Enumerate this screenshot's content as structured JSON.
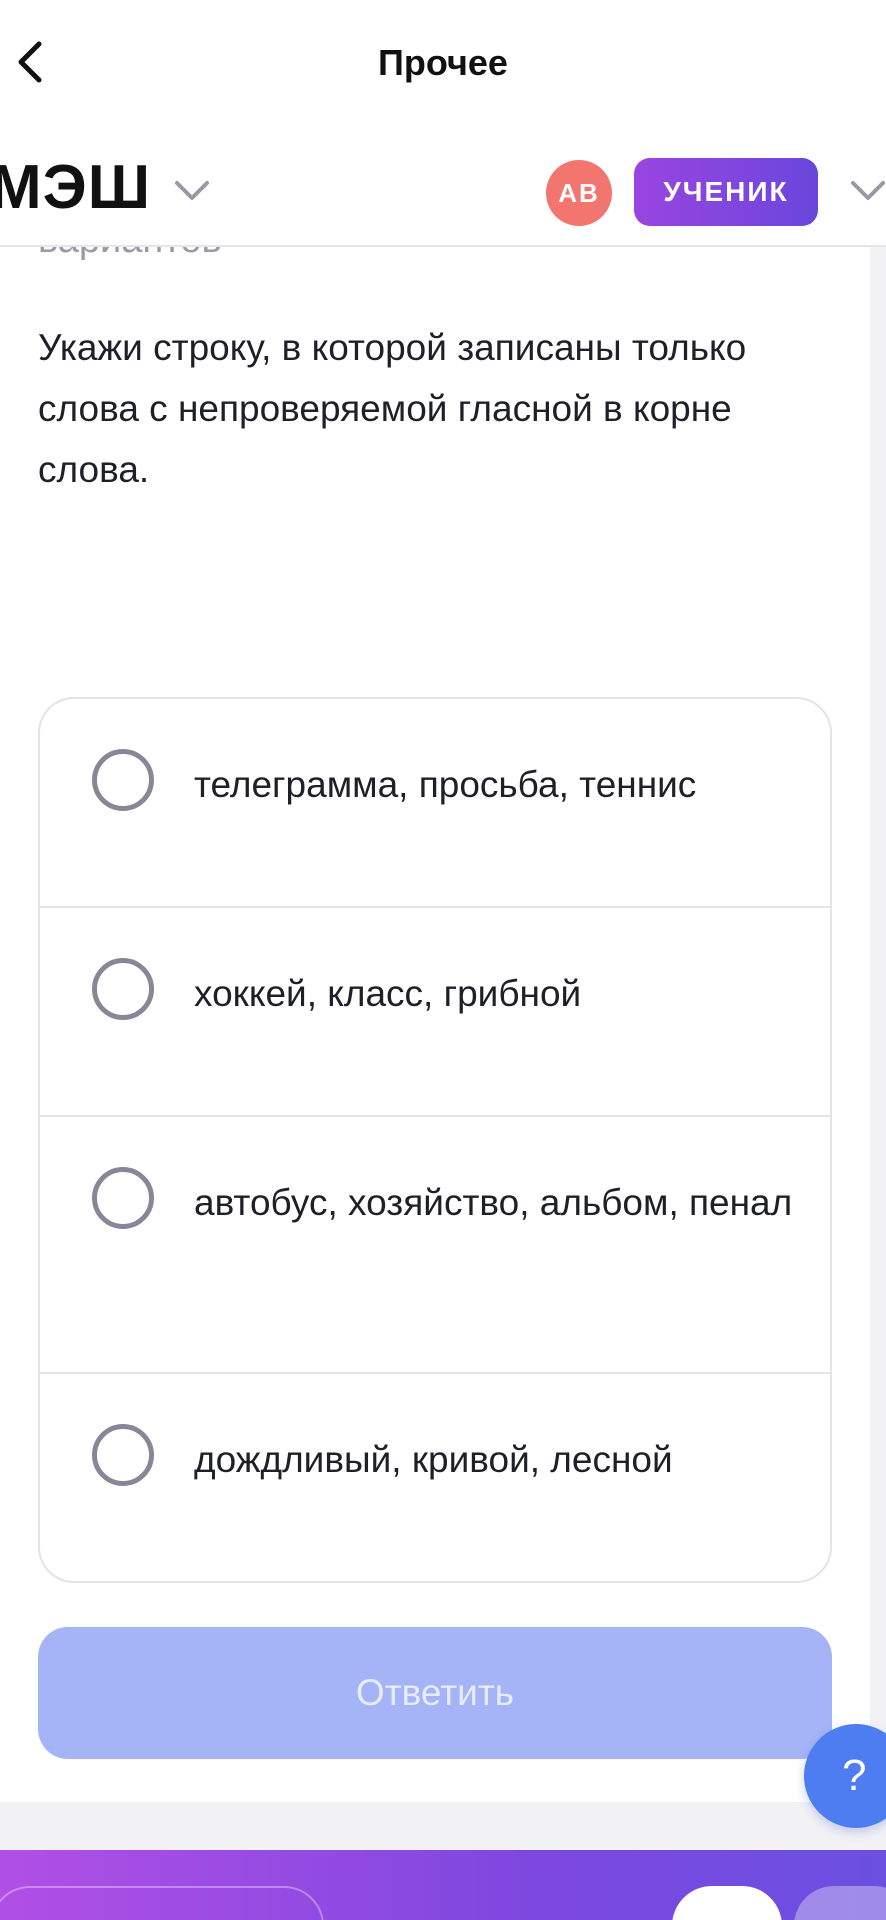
{
  "navbar": {
    "title": "Прочее"
  },
  "header": {
    "logo": "МЭШ",
    "avatar_initials": "АВ",
    "role_label": "УЧЕНИК"
  },
  "task": {
    "cut_heading": "вариантов",
    "question": "Укажи строку, в которой записаны только слова с непроверяемой гласной в корне слова.",
    "options": [
      "телеграмма, просьба, теннис",
      "хоккей, класс, грибной",
      "автобус, хозяйство, альбом, пенал",
      "дождливый, кривой, лесной"
    ],
    "submit_label": "Ответить"
  },
  "help": {
    "label": "?"
  },
  "colors": {
    "accent_purple": "#7d48df",
    "submit_disabled": "#a5b4f6",
    "avatar_bg": "#f27570",
    "help_bg": "#4d7df0"
  }
}
